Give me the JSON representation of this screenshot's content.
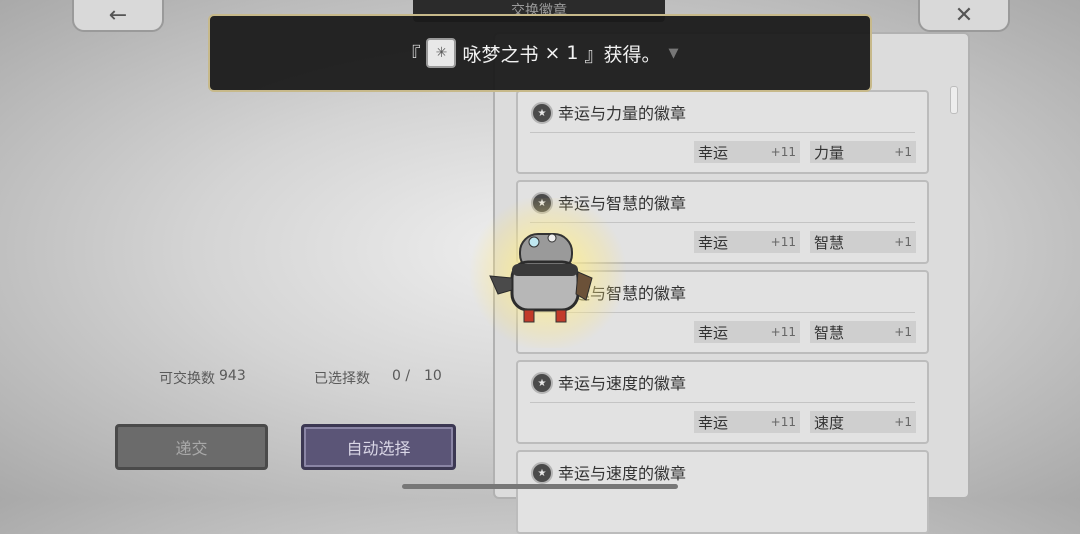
{
  "header": {
    "title": "交换徽章",
    "back_icon": "←",
    "close_icon": "✕"
  },
  "toast": {
    "open_bracket": "『",
    "item_name": "咏梦之书",
    "qty": "× 1",
    "suffix": "』获得。",
    "item_icon": "book-icon"
  },
  "badges": [
    {
      "name": "幸运与力量的徽章",
      "stats": [
        {
          "name": "幸运",
          "value": "+11"
        },
        {
          "name": "力量",
          "value": "+1"
        }
      ]
    },
    {
      "name": "幸运与智慧的徽章",
      "stats": [
        {
          "name": "幸运",
          "value": "+11"
        },
        {
          "name": "智慧",
          "value": "+1"
        }
      ]
    },
    {
      "name": "幸运与智慧的徽章",
      "stats": [
        {
          "name": "幸运",
          "value": "+11"
        },
        {
          "name": "智慧",
          "value": "+1"
        }
      ]
    },
    {
      "name": "幸运与速度的徽章",
      "stats": [
        {
          "name": "幸运",
          "value": "+11"
        },
        {
          "name": "速度",
          "value": "+1"
        }
      ]
    },
    {
      "name": "幸运与速度的徽章",
      "stats": []
    }
  ],
  "footer": {
    "exchangeable_label": "可交换数",
    "exchangeable_count": "943",
    "selected_label": "已选择数",
    "selected_count": "0 /",
    "selected_max": "10",
    "submit_label": "递交",
    "auto_select_label": "自动选择"
  }
}
